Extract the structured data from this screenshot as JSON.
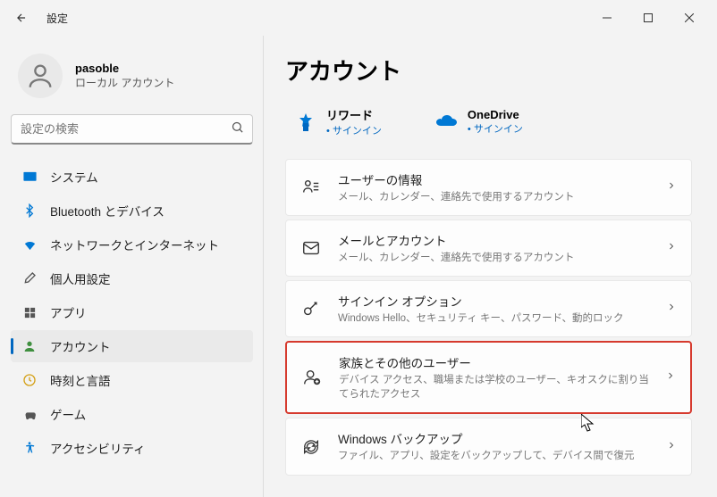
{
  "titlebar": {
    "title": "設定"
  },
  "profile": {
    "name": "pasoble",
    "subtitle": "ローカル アカウント"
  },
  "search": {
    "placeholder": "設定の検索"
  },
  "sidebar": {
    "items": [
      {
        "label": "システム"
      },
      {
        "label": "Bluetooth とデバイス"
      },
      {
        "label": "ネットワークとインターネット"
      },
      {
        "label": "個人用設定"
      },
      {
        "label": "アプリ"
      },
      {
        "label": "アカウント"
      },
      {
        "label": "時刻と言語"
      },
      {
        "label": "ゲーム"
      },
      {
        "label": "アクセシビリティ"
      }
    ]
  },
  "content": {
    "page_title": "アカウント",
    "quick_cards": [
      {
        "title": "リワード",
        "sub": "サインイン"
      },
      {
        "title": "OneDrive",
        "sub": "サインイン"
      }
    ],
    "items": [
      {
        "title": "ユーザーの情報",
        "sub": "メール、カレンダー、連絡先で使用するアカウント"
      },
      {
        "title": "メールとアカウント",
        "sub": "メール、カレンダー、連絡先で使用するアカウント"
      },
      {
        "title": "サインイン オプション",
        "sub": "Windows Hello、セキュリティ キー、パスワード、動的ロック"
      },
      {
        "title": "家族とその他のユーザー",
        "sub": "デバイス アクセス、職場または学校のユーザー、キオスクに割り当てられたアクセス"
      },
      {
        "title": "Windows バックアップ",
        "sub": "ファイル、アプリ、設定をバックアップして、デバイス間で復元"
      }
    ]
  }
}
